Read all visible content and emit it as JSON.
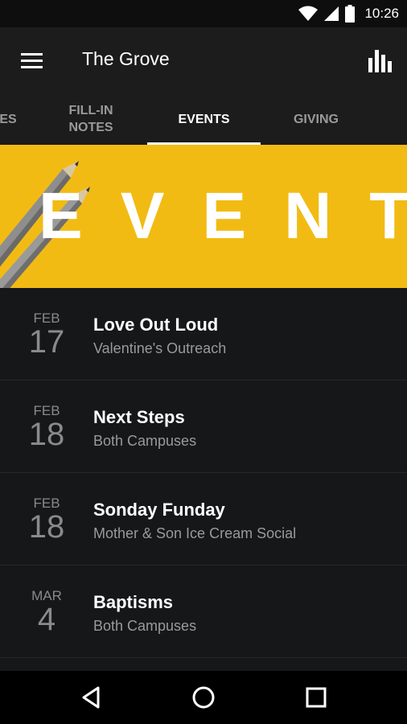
{
  "status_bar": {
    "time": "10:26"
  },
  "app_bar": {
    "title": "The Grove"
  },
  "tabs": [
    {
      "label": "ES"
    },
    {
      "label": "FILL-IN\nNOTES"
    },
    {
      "label": "EVENTS"
    },
    {
      "label": "GIVING"
    }
  ],
  "banner": {
    "text": "EVENTS"
  },
  "events": [
    {
      "month": "FEB",
      "day": "17",
      "title": "Love Out Loud",
      "subtitle": "Valentine's Outreach"
    },
    {
      "month": "FEB",
      "day": "18",
      "title": "Next Steps",
      "subtitle": "Both Campuses"
    },
    {
      "month": "FEB",
      "day": "18",
      "title": "Sonday Funday",
      "subtitle": "Mother & Son Ice Cream Social"
    },
    {
      "month": "MAR",
      "day": "4",
      "title": "Baptisms",
      "subtitle": "Both Campuses"
    }
  ],
  "colors": {
    "accent": "#f2bb14",
    "background": "#161718",
    "app_bar": "#1c1c1c"
  }
}
